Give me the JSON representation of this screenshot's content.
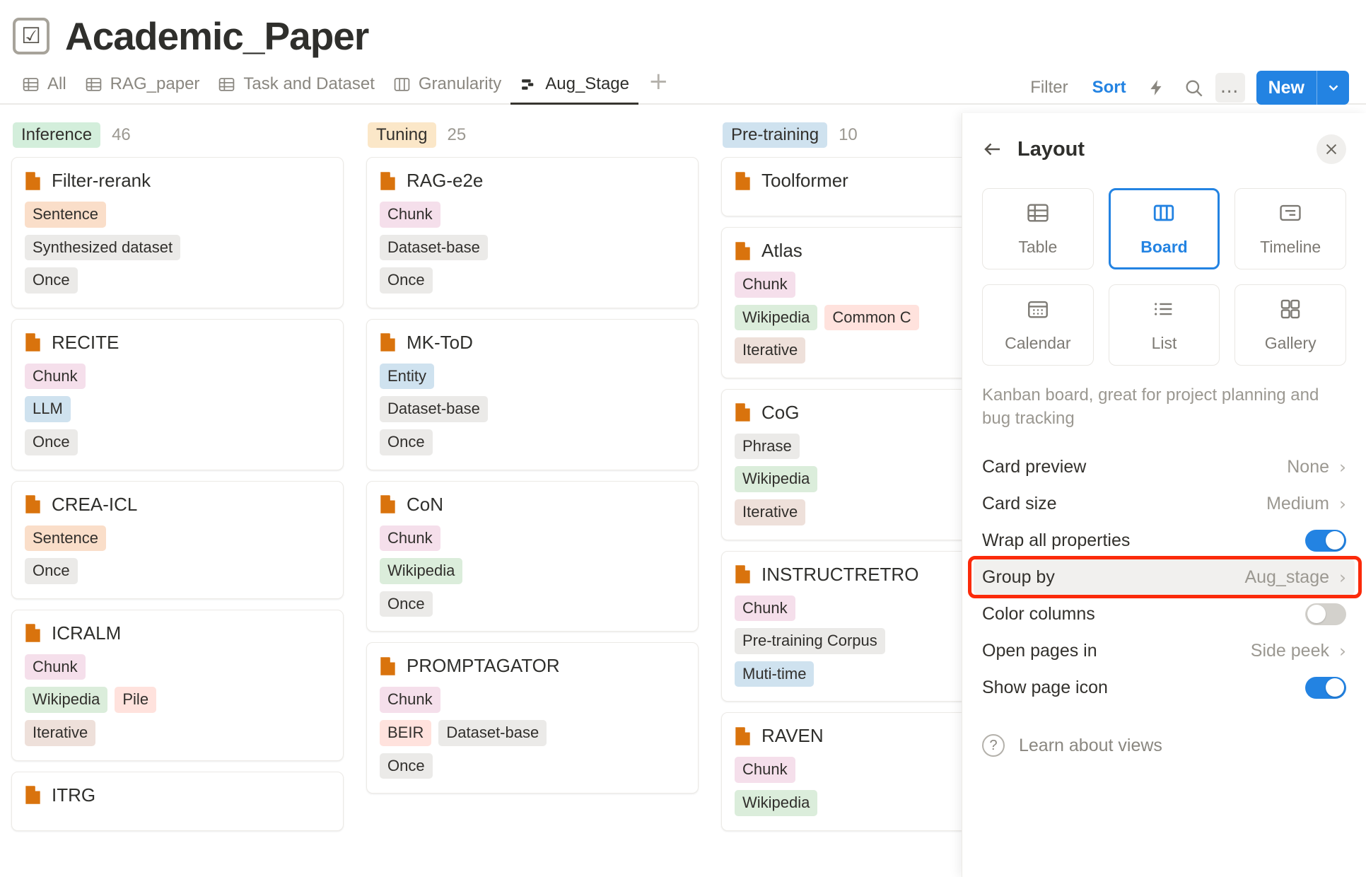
{
  "header": {
    "icon": "checkbox-icon",
    "title": "Academic_Paper"
  },
  "tabs": [
    {
      "label": "All",
      "icon": "table-icon",
      "active": false
    },
    {
      "label": "RAG_paper",
      "icon": "table-icon",
      "active": false
    },
    {
      "label": "Task and Dataset",
      "icon": "table-icon",
      "active": false
    },
    {
      "label": "Granularity",
      "icon": "board-icon",
      "active": false
    },
    {
      "label": "Aug_Stage",
      "icon": "kanban-icon",
      "active": true
    }
  ],
  "tab_add_label": "+",
  "toolbar": {
    "filter_label": "Filter",
    "sort_label": "Sort",
    "lightning_icon": "lightning-icon",
    "search_icon": "search-icon",
    "more_icon": "ellipsis-icon",
    "new_label": "New",
    "new_caret_icon": "chevron-down-icon"
  },
  "board": {
    "columns": [
      {
        "name": "Inference",
        "count": "46",
        "chip_color": "#d3eedb",
        "cards": [
          {
            "title": "Filter-rerank",
            "rows": [
              [
                {
                  "t": "Sentence",
                  "c": "#fadec9"
                }
              ],
              [
                {
                  "t": "Synthesized dataset",
                  "c": "#ebeae8"
                }
              ],
              [
                {
                  "t": "Once",
                  "c": "#ebeae8"
                }
              ]
            ]
          },
          {
            "title": "RECITE",
            "rows": [
              [
                {
                  "t": "Chunk",
                  "c": "#f5dfeb"
                }
              ],
              [
                {
                  "t": "LLM",
                  "c": "#cfe2ef"
                }
              ],
              [
                {
                  "t": "Once",
                  "c": "#ebeae8"
                }
              ]
            ]
          },
          {
            "title": "CREA-ICL",
            "rows": [
              [
                {
                  "t": "Sentence",
                  "c": "#fadec9"
                }
              ],
              [
                {
                  "t": "Once",
                  "c": "#ebeae8"
                }
              ]
            ]
          },
          {
            "title": "ICRALM",
            "rows": [
              [
                {
                  "t": "Chunk",
                  "c": "#f5dfeb"
                }
              ],
              [
                {
                  "t": "Wikipedia",
                  "c": "#dbeddb"
                },
                {
                  "t": "Pile",
                  "c": "#ffe2dd"
                }
              ],
              [
                {
                  "t": "Iterative",
                  "c": "#eee0da"
                }
              ]
            ]
          },
          {
            "title": "ITRG",
            "rows": []
          }
        ]
      },
      {
        "name": "Tuning",
        "count": "25",
        "chip_color": "#fbe7c8",
        "cards": [
          {
            "title": "RAG-e2e",
            "rows": [
              [
                {
                  "t": "Chunk",
                  "c": "#f5dfeb"
                }
              ],
              [
                {
                  "t": "Dataset-base",
                  "c": "#ebeae8"
                }
              ],
              [
                {
                  "t": "Once",
                  "c": "#ebeae8"
                }
              ]
            ]
          },
          {
            "title": "MK-ToD",
            "rows": [
              [
                {
                  "t": "Entity",
                  "c": "#cfe2ef"
                }
              ],
              [
                {
                  "t": "Dataset-base",
                  "c": "#ebeae8"
                }
              ],
              [
                {
                  "t": "Once",
                  "c": "#ebeae8"
                }
              ]
            ]
          },
          {
            "title": "CoN",
            "rows": [
              [
                {
                  "t": "Chunk",
                  "c": "#f5dfeb"
                }
              ],
              [
                {
                  "t": "Wikipedia",
                  "c": "#dbeddb"
                }
              ],
              [
                {
                  "t": "Once",
                  "c": "#ebeae8"
                }
              ]
            ]
          },
          {
            "title": "PROMPTAGATOR",
            "rows": [
              [
                {
                  "t": "Chunk",
                  "c": "#f5dfeb"
                }
              ],
              [
                {
                  "t": "BEIR",
                  "c": "#ffe2dd"
                },
                {
                  "t": "Dataset-base",
                  "c": "#ebeae8"
                }
              ],
              [
                {
                  "t": "Once",
                  "c": "#ebeae8"
                }
              ]
            ]
          }
        ]
      },
      {
        "name": "Pre-training",
        "count": "10",
        "chip_color": "#cfe2ef",
        "cards": [
          {
            "title": "Toolformer",
            "rows": []
          },
          {
            "title": "Atlas",
            "rows": [
              [
                {
                  "t": "Chunk",
                  "c": "#f5dfeb"
                }
              ],
              [
                {
                  "t": "Wikipedia",
                  "c": "#dbeddb"
                },
                {
                  "t": "Common C",
                  "c": "#ffe2dd"
                }
              ],
              [
                {
                  "t": "Iterative",
                  "c": "#eee0da"
                }
              ]
            ]
          },
          {
            "title": "CoG",
            "rows": [
              [
                {
                  "t": "Phrase",
                  "c": "#ebeae8"
                }
              ],
              [
                {
                  "t": "Wikipedia",
                  "c": "#dbeddb"
                }
              ],
              [
                {
                  "t": "Iterative",
                  "c": "#eee0da"
                }
              ]
            ]
          },
          {
            "title": "INSTRUCTRETRO",
            "rows": [
              [
                {
                  "t": "Chunk",
                  "c": "#f5dfeb"
                }
              ],
              [
                {
                  "t": "Pre-training Corpus",
                  "c": "#ebeae8"
                }
              ],
              [
                {
                  "t": "Muti-time",
                  "c": "#cfe2ef"
                }
              ]
            ]
          },
          {
            "title": "RAVEN",
            "rows": [
              [
                {
                  "t": "Chunk",
                  "c": "#f5dfeb"
                }
              ],
              [
                {
                  "t": "Wikipedia",
                  "c": "#dbeddb"
                }
              ]
            ]
          }
        ]
      }
    ]
  },
  "panel": {
    "back_icon": "back-arrow-icon",
    "title": "Layout",
    "close_icon": "close-icon",
    "layouts": [
      {
        "label": "Table",
        "icon": "table-icon",
        "selected": false
      },
      {
        "label": "Board",
        "icon": "board-icon",
        "selected": true
      },
      {
        "label": "Timeline",
        "icon": "timeline-icon",
        "selected": false
      },
      {
        "label": "Calendar",
        "icon": "calendar-icon",
        "selected": false
      },
      {
        "label": "List",
        "icon": "list-icon",
        "selected": false
      },
      {
        "label": "Gallery",
        "icon": "gallery-icon",
        "selected": false
      }
    ],
    "description": "Kanban board, great for project planning and bug tracking",
    "options": [
      {
        "name": "Card preview",
        "value": "None",
        "type": "value"
      },
      {
        "name": "Card size",
        "value": "Medium",
        "type": "value"
      },
      {
        "name": "Wrap all properties",
        "value": "on",
        "type": "toggle"
      },
      {
        "name": "Group by",
        "value": "Aug_stage",
        "type": "value",
        "highlighted": true
      },
      {
        "name": "Color columns",
        "value": "off",
        "type": "toggle"
      },
      {
        "name": "Open pages in",
        "value": "Side peek",
        "type": "value"
      },
      {
        "name": "Show page icon",
        "value": "on",
        "type": "toggle"
      }
    ],
    "learn_label": "Learn about views",
    "learn_icon": "question-circle-icon",
    "highlight_color": "#fb2a0a"
  }
}
